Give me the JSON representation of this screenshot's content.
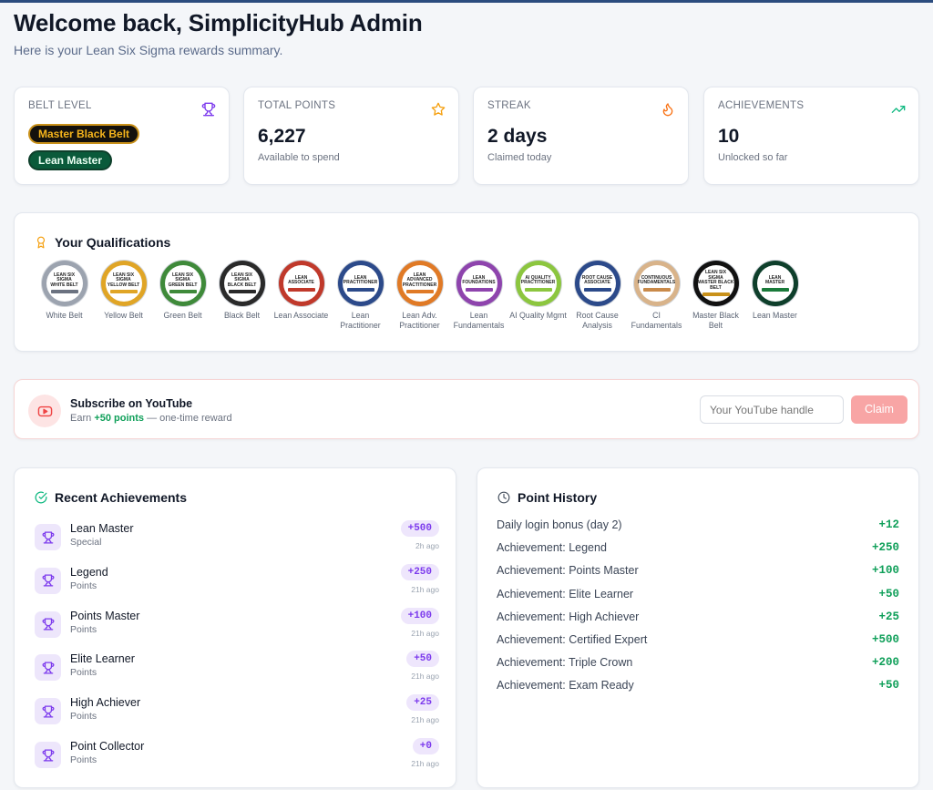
{
  "header": {
    "title": "Welcome back, SimplicityHub Admin",
    "subtitle": "Here is your Lean Six Sigma rewards summary."
  },
  "stats": {
    "belt": {
      "label": "BELT LEVEL",
      "badges": [
        "Master Black Belt",
        "Lean Master"
      ],
      "icon": "trophy-icon"
    },
    "points": {
      "label": "TOTAL POINTS",
      "value": "6,227",
      "sub": "Available to spend",
      "icon": "star-icon"
    },
    "streak": {
      "label": "STREAK",
      "value": "2 days",
      "sub": "Claimed today",
      "icon": "flame-icon"
    },
    "achievements": {
      "label": "ACHIEVEMENTS",
      "value": "10",
      "sub": "Unlocked so far",
      "icon": "trending-up-icon"
    }
  },
  "qualifications": {
    "title": "Your Qualifications",
    "items": [
      {
        "label": "White Belt",
        "seal_text": [
          "LEAN SIX SIGMA",
          "WHITE BELT"
        ],
        "ring": "#9ca3af",
        "band": "#6b7280"
      },
      {
        "label": "Yellow Belt",
        "seal_text": [
          "LEAN SIX SIGMA",
          "YELLOW BELT"
        ],
        "ring": "#e0a526",
        "band": "#e0a526"
      },
      {
        "label": "Green Belt",
        "seal_text": [
          "LEAN SIX SIGMA",
          "GREEN BELT"
        ],
        "ring": "#3f8a3a",
        "band": "#3f8a3a"
      },
      {
        "label": "Black Belt",
        "seal_text": [
          "LEAN SIX SIGMA",
          "BLACK BELT"
        ],
        "ring": "#2a2a2a",
        "band": "#2a2a2a"
      },
      {
        "label": "Lean Associate",
        "seal_text": [
          "LEAN",
          "ASSOCIATE"
        ],
        "ring": "#c0392b",
        "band": "#c0392b"
      },
      {
        "label": "Lean Practitioner",
        "seal_text": [
          "LEAN",
          "PRACTITIONER"
        ],
        "ring": "#2c4a8a",
        "band": "#2c4a8a"
      },
      {
        "label": "Lean Adv. Practitioner",
        "seal_text": [
          "LEAN",
          "ADVANCED PRACTITIONER"
        ],
        "ring": "#e07a26",
        "band": "#e07a26"
      },
      {
        "label": "Lean Fundamentals",
        "seal_text": [
          "LEAN",
          "FOUNDATIONS"
        ],
        "ring": "#8e44ad",
        "band": "#8e44ad"
      },
      {
        "label": "AI Quality Mgmt",
        "seal_text": [
          "AI QUALITY",
          "PRACTITIONER"
        ],
        "ring": "#8cc63f",
        "band": "#8cc63f"
      },
      {
        "label": "Root Cause Analysis",
        "seal_text": [
          "ROOT CAUSE",
          "ASSOCIATE"
        ],
        "ring": "#2c4a8a",
        "band": "#2c4a8a"
      },
      {
        "label": "CI Fundamentals",
        "seal_text": [
          "CONTINUOUS",
          "FUNDAMENTALS"
        ],
        "ring": "#d8b38a",
        "band": "#c98a4a"
      },
      {
        "label": "Master Black Belt",
        "seal_text": [
          "LEAN SIX SIGMA",
          "MASTER BLACK BELT"
        ],
        "ring": "#111111",
        "band": "#c9911a"
      },
      {
        "label": "Lean Master",
        "seal_text": [
          "LEAN",
          "MASTER"
        ],
        "ring": "#0e3f2b",
        "band": "#1a7a3a"
      }
    ]
  },
  "youtube": {
    "title": "Subscribe on YouTube",
    "sub_prefix": "Earn",
    "sub_points": "+50 points",
    "sub_suffix": "— one-time reward",
    "placeholder": "Your YouTube handle",
    "button": "Claim"
  },
  "recent": {
    "title": "Recent Achievements",
    "items": [
      {
        "name": "Lean Master",
        "category": "Special",
        "points": "+500",
        "time": "2h ago"
      },
      {
        "name": "Legend",
        "category": "Points",
        "points": "+250",
        "time": "21h ago"
      },
      {
        "name": "Points Master",
        "category": "Points",
        "points": "+100",
        "time": "21h ago"
      },
      {
        "name": "Elite Learner",
        "category": "Points",
        "points": "+50",
        "time": "21h ago"
      },
      {
        "name": "High Achiever",
        "category": "Points",
        "points": "+25",
        "time": "21h ago"
      },
      {
        "name": "Point Collector",
        "category": "Points",
        "points": "+0",
        "time": "21h ago"
      }
    ]
  },
  "history": {
    "title": "Point History",
    "items": [
      {
        "label": "Daily login bonus (day 2)",
        "value": "+12"
      },
      {
        "label": "Achievement: Legend",
        "value": "+250"
      },
      {
        "label": "Achievement: Points Master",
        "value": "+100"
      },
      {
        "label": "Achievement: Elite Learner",
        "value": "+50"
      },
      {
        "label": "Achievement: High Achiever",
        "value": "+25"
      },
      {
        "label": "Achievement: Certified Expert",
        "value": "+500"
      },
      {
        "label": "Achievement: Triple Crown",
        "value": "+200"
      },
      {
        "label": "Achievement: Exam Ready",
        "value": "+50"
      }
    ]
  },
  "colors": {
    "accent_purple": "#7c3aed",
    "positive_green": "#0f9f59",
    "youtube_red": "#ef4444"
  }
}
